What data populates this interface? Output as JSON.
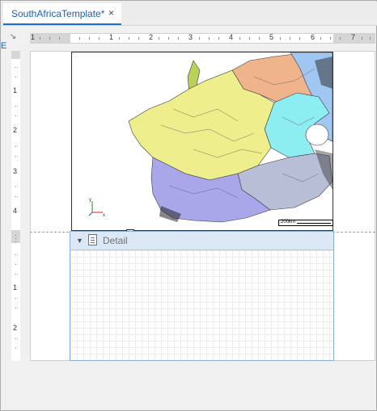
{
  "tab": {
    "title": "SouthAfricaTemplate*",
    "close": "×"
  },
  "corner": {
    "icon": "resize-corner-icon",
    "glyph": "↘"
  },
  "side_hint": "E",
  "hruler": {
    "labels": [
      "1",
      "1",
      "2",
      "3",
      "4",
      "5",
      "6",
      "7"
    ]
  },
  "vruler": {
    "labels": [
      "1",
      "2",
      "3",
      "4",
      "1",
      "2"
    ]
  },
  "map": {
    "scale_label": "200km",
    "axis": {
      "y": "y",
      "x": "x"
    },
    "colors": {
      "purple": "#a9a6ea",
      "yellow": "#eeee8d",
      "cyan": "#8ceef0",
      "orange": "#f0b48c",
      "blue": "#9fc7f2",
      "olive": "#b8d25a",
      "gray": "#b8bed6"
    }
  },
  "detail": {
    "label": "Detail",
    "collapse_icon": "▼",
    "smart_tag": "⋗"
  }
}
